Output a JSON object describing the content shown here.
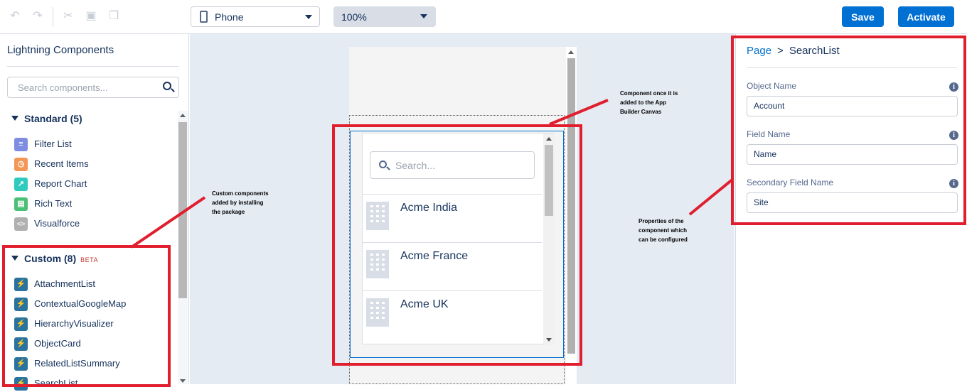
{
  "toolbar": {
    "device": "Phone",
    "zoom": "100%",
    "save_label": "Save",
    "activate_label": "Activate",
    "icons": [
      "undo-icon",
      "redo-icon",
      "cut-icon",
      "paste-icon",
      "copy-icon"
    ]
  },
  "left_panel": {
    "title": "Lightning Components",
    "search_placeholder": "Search components...",
    "standard": {
      "heading": "Standard (5)",
      "items": [
        {
          "label": "Filter List",
          "color": "#7f8de1",
          "glyph": "≡"
        },
        {
          "label": "Recent Items",
          "color": "#f49756",
          "glyph": "◷"
        },
        {
          "label": "Report Chart",
          "color": "#2ecbbe",
          "glyph": "↗"
        },
        {
          "label": "Rich Text",
          "color": "#4bc076",
          "glyph": "▤"
        },
        {
          "label": "Visualforce",
          "color": "#b0b0b0",
          "glyph": "</>"
        }
      ]
    },
    "custom": {
      "heading": "Custom (8)",
      "badge": "BETA",
      "items": [
        {
          "label": "AttachmentList",
          "color": "#2a739e",
          "glyph": "⚡"
        },
        {
          "label": "ContextualGoogleMap",
          "color": "#2a739e",
          "glyph": "⚡"
        },
        {
          "label": "HierarchyVisualizer",
          "color": "#2a739e",
          "glyph": "⚡"
        },
        {
          "label": "ObjectCard",
          "color": "#2a739e",
          "glyph": "⚡"
        },
        {
          "label": "RelatedListSummary",
          "color": "#2a739e",
          "glyph": "⚡"
        },
        {
          "label": "SearchList",
          "color": "#2a739e",
          "glyph": "⚡"
        }
      ]
    }
  },
  "canvas": {
    "search_placeholder": "Search...",
    "accounts": [
      "Acme India",
      "Acme France",
      "Acme UK"
    ]
  },
  "right_panel": {
    "breadcrumb_link": "Page",
    "breadcrumb_sep": ">",
    "breadcrumb_current": "SearchList",
    "props": [
      {
        "label": "Object Name",
        "value": "Account"
      },
      {
        "label": "Field Name",
        "value": "Name"
      },
      {
        "label": "Secondary Field Name",
        "value": "Site"
      }
    ]
  },
  "annotations": {
    "canvas_note": [
      "Component once it is",
      "added to the App",
      "Builder Canvas"
    ],
    "custom_note": [
      "Custom components",
      "added by installing",
      "the package"
    ],
    "props_note": [
      "Properties of the",
      "component which",
      "can be configured"
    ],
    "color": "#e01e2e"
  }
}
